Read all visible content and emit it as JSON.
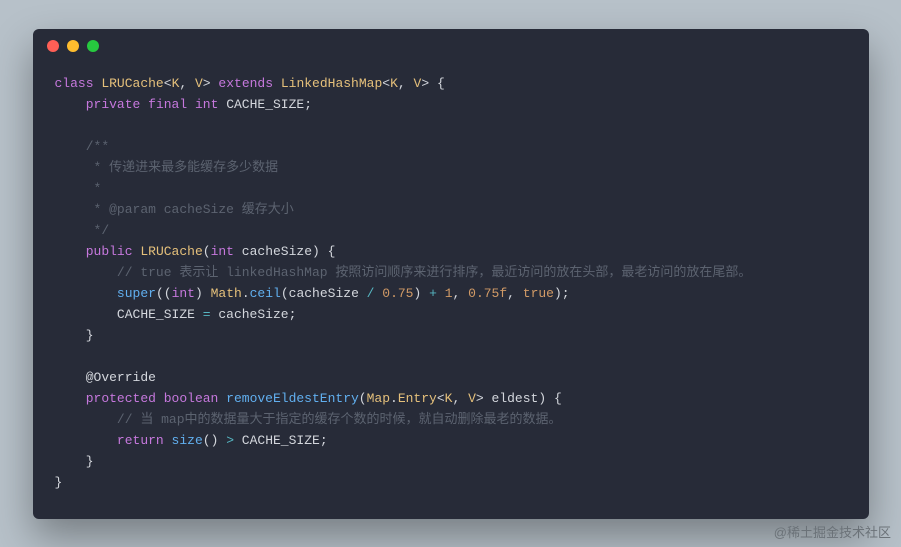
{
  "watermark": "@稀土掘金技术社区",
  "code": {
    "l1": {
      "kw_class": "class",
      "cls": "LRUCache",
      "lt": "<",
      "K": "K",
      "comma": ", ",
      "V": "V",
      "gt": ">",
      "kw_extends": "extends",
      "parent": "LinkedHashMap",
      "lt2": "<",
      "K2": "K",
      "comma2": ", ",
      "V2": "V",
      "gt2": ">",
      "brace": "{"
    },
    "l2": {
      "kw_private": "private",
      "kw_final": "final",
      "kw_int": "int",
      "name": "CACHE_SIZE",
      "semi": ";"
    },
    "l3": {
      "c": "/**"
    },
    "l4": {
      "c": " * 传递进来最多能缓存多少数据"
    },
    "l5": {
      "c": " *"
    },
    "l6": {
      "c": " * @param cacheSize 缓存大小"
    },
    "l7": {
      "c": " */"
    },
    "l8": {
      "kw_public": "public",
      "cls": "LRUCache",
      "lp": "(",
      "kw_int": "int",
      "param": "cacheSize",
      "rp": ")",
      "brace": "{"
    },
    "l9": {
      "c": "// true 表示让 linkedHashMap 按照访问顺序来进行排序，最近访问的放在头部，最老访问的放在尾部。"
    },
    "l10": {
      "super": "super",
      "lp": "(",
      "lp2": "(",
      "cast": "int",
      "rp2": ")",
      "Math": "Math",
      "dot": ".",
      "ceil": "ceil",
      "lp3": "(",
      "arg": "cacheSize",
      "div": " / ",
      "n075": "0.75",
      "rp3": ")",
      "plus": " + ",
      "n1": "1",
      "c1": ", ",
      "n075f": "0.75f",
      "c2": ", ",
      "true": "true",
      "rp": ")",
      "semi": ";"
    },
    "l11": {
      "lhs": "CACHE_SIZE",
      "eq": " = ",
      "rhs": "cacheSize",
      "semi": ";"
    },
    "l12": {
      "brace": "}"
    },
    "l13": {
      "anno": "@Override"
    },
    "l14": {
      "kw_protected": "protected",
      "kw_boolean": "boolean",
      "fn": "removeEldestEntry",
      "lp": "(",
      "Map": "Map",
      "dot": ".",
      "Entry": "Entry",
      "lt": "<",
      "K": "K",
      "comma": ", ",
      "V": "V",
      "gt": ">",
      "param": "eldest",
      "rp": ")",
      "brace": "{"
    },
    "l15": {
      "c": "// 当 map中的数据量大于指定的缓存个数的时候，就自动删除最老的数据。"
    },
    "l16": {
      "kw_return": "return",
      "size": "size",
      "lp": "(",
      "rp": ")",
      "gt": " > ",
      "rhs": "CACHE_SIZE",
      "semi": ";"
    },
    "l17": {
      "brace": "}"
    },
    "l18": {
      "brace": "}"
    }
  }
}
